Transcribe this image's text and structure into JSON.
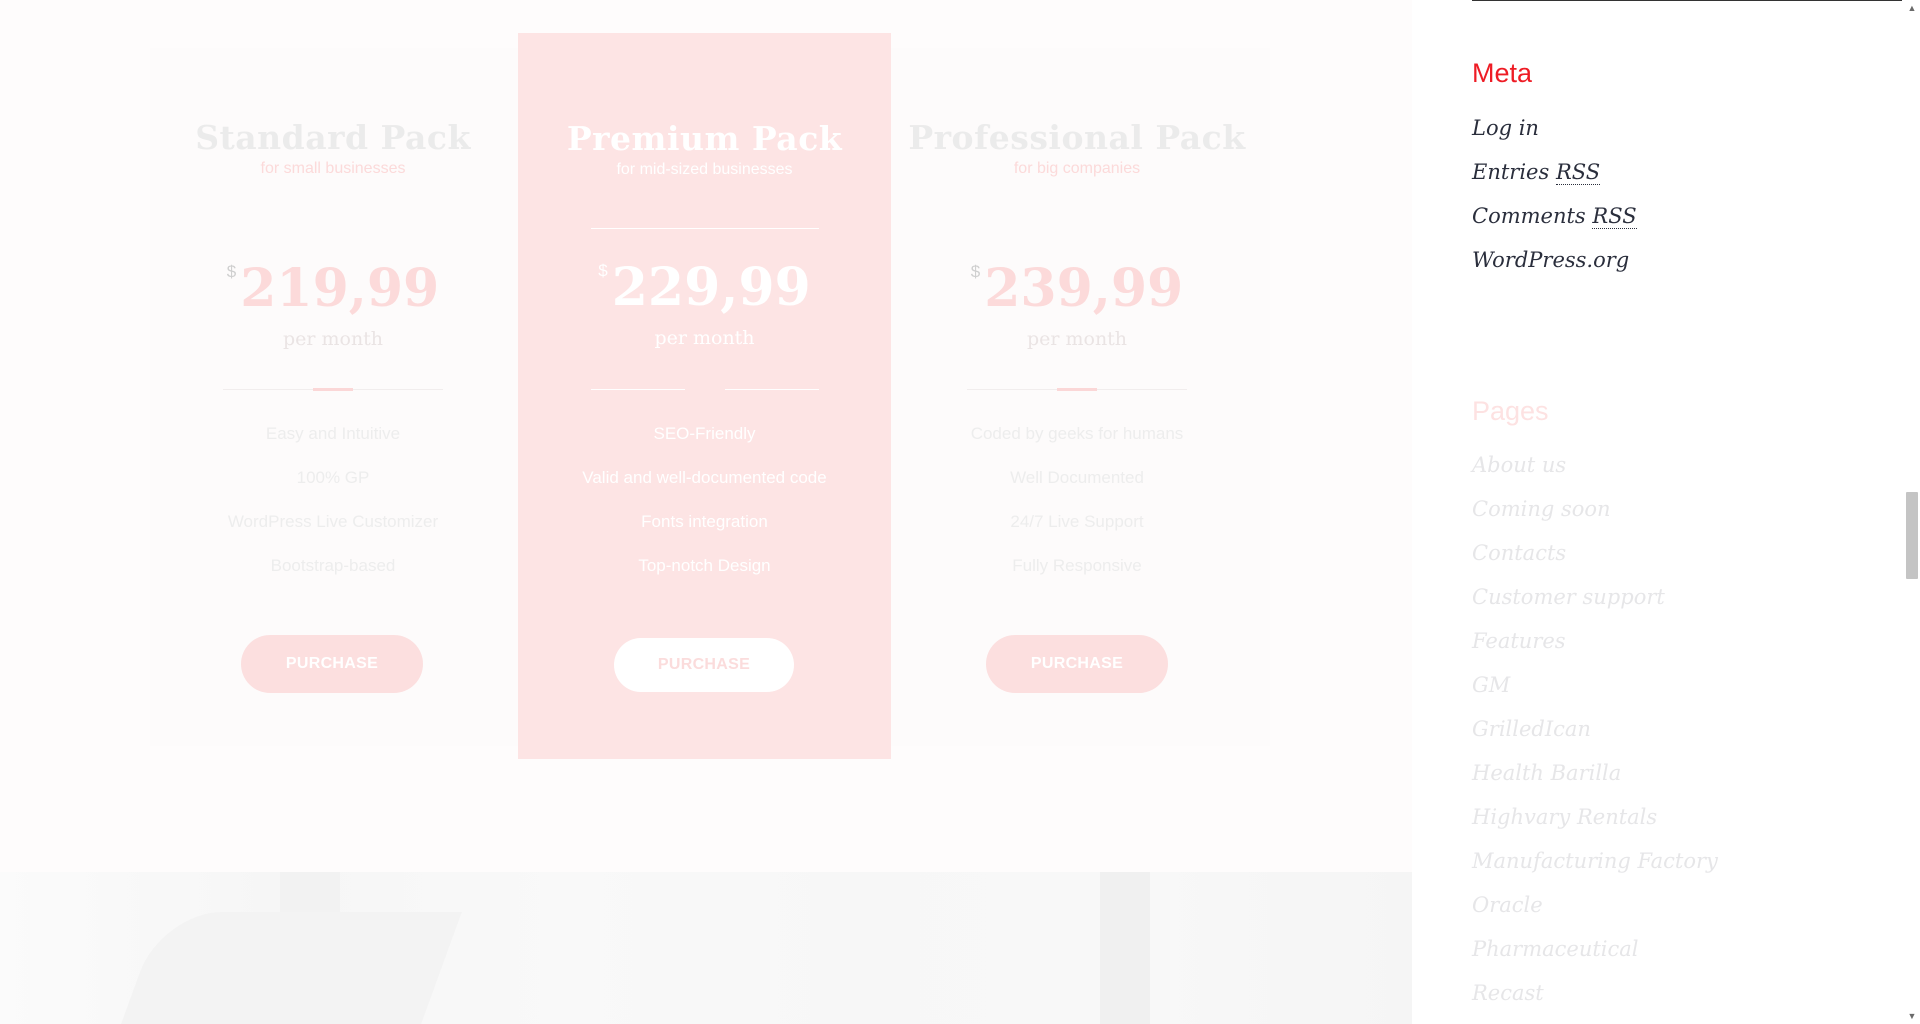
{
  "pricing": {
    "packs": [
      {
        "title": "Standard Pack",
        "subtitle": "for small businesses",
        "currency": "$",
        "price": "219,99",
        "period": "per month",
        "features": [
          "Easy and Intuitive",
          "100% GP",
          "WordPress Live Customizer",
          "Bootstrap-based"
        ],
        "button": "PURCHASE"
      },
      {
        "title": "Premium Pack",
        "subtitle": "for mid-sized businesses",
        "currency": "$",
        "price": "229,99",
        "period": "per month",
        "features": [
          "SEO-Friendly",
          "Valid and well-documented code",
          "Fonts integration",
          "Top-notch Design"
        ],
        "button": "PURCHASE"
      },
      {
        "title": "Professional Pack",
        "subtitle": "for big companies",
        "currency": "$",
        "price": "239,99",
        "period": "per month",
        "features": [
          "Coded by geeks for humans",
          "Well Documented",
          "24/7 Live Support",
          "Fully Responsive"
        ],
        "button": "PURCHASE"
      }
    ]
  },
  "sidebar": {
    "meta": {
      "title": "Meta",
      "items": [
        {
          "label": "Log in"
        },
        {
          "label": "Entries",
          "abbr": "RSS"
        },
        {
          "label": "Comments",
          "abbr": "RSS"
        },
        {
          "label": "WordPress.org"
        }
      ]
    },
    "pages": {
      "title": "Pages",
      "items": [
        "About us",
        "Coming soon",
        "Contacts",
        "Customer support",
        "Features",
        "GM",
        "GrilledIcan",
        "Health Barilla",
        "Highvary Rentals",
        "Manufacturing Factory",
        "Oracle",
        "Pharmaceutical",
        "Recast"
      ]
    }
  },
  "colors": {
    "accent": "#ee1c25",
    "premium_bg": "#fde4e4",
    "faded_pink": "#fcdada"
  },
  "icons": {
    "scroll_up": "triangle-up-icon",
    "scroll_down": "triangle-down-icon"
  }
}
